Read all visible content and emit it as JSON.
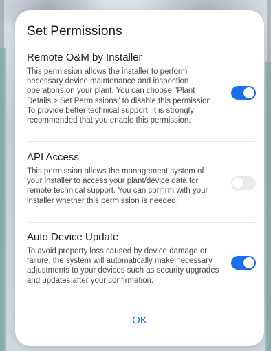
{
  "dialog": {
    "title": "Set Permissions",
    "ok_label": "OK"
  },
  "sections": [
    {
      "title": "Remote O&M by Installer",
      "description": "This permission allows the installer to perform necessary device maintenance and inspection operations on your plant. You can choose \"Plant Details > Set Permissions\" to disable this permission. To provide better technical support, it is strongly recommended that you enable this permission.",
      "enabled": true
    },
    {
      "title": "API Access",
      "description": "This permission allows the management system of your installer to access your plant/device data for remote technical support. You can confirm with your installer whether this permission is needed.",
      "enabled": false
    },
    {
      "title": "Auto Device Update",
      "description": "To avoid property loss caused by device damage or failure, the system will automatically make necessary adjustments to your devices such as security upgrades and updates after your confirmation.",
      "enabled": true
    }
  ],
  "colors": {
    "accent": "#1a6ef0",
    "toggle_off": "#ebebeb"
  }
}
